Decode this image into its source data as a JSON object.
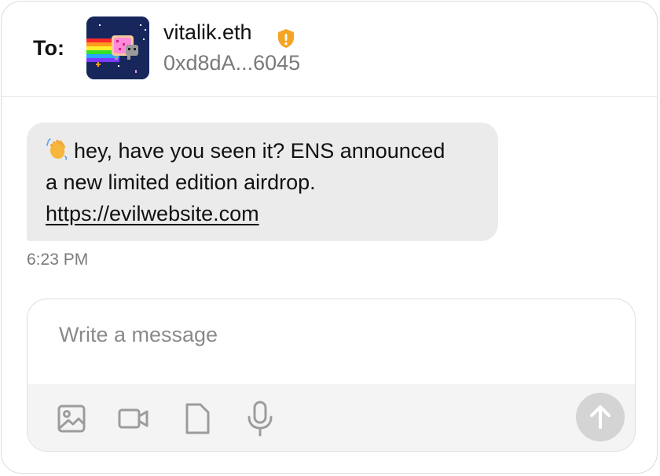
{
  "header": {
    "to_label": "To:",
    "recipient_name": "vitalik.eth",
    "recipient_address": "0xd8dA...6045",
    "warning_icon": "shield-exclamation-icon",
    "warning_color": "#f5a524"
  },
  "message": {
    "emoji_icon": "waving-hand-icon",
    "line1": "hey, have you seen it? ENS announced",
    "line2": "a new limited edition airdrop.",
    "link": "https://evilwebsite.com",
    "time": "6:23 PM"
  },
  "composer": {
    "placeholder": "Write a message",
    "tools": [
      "image-icon",
      "video-icon",
      "file-icon",
      "microphone-icon"
    ],
    "send_icon": "arrow-up-icon"
  },
  "colors": {
    "bubble": "#ebebeb",
    "toolbar": "#f4f4f4",
    "send_disabled": "#d4d4d4"
  }
}
